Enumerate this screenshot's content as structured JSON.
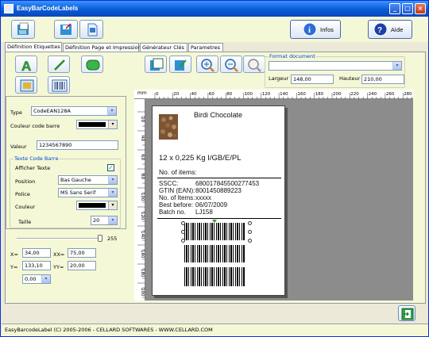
{
  "window": {
    "title": "EasyBarCodeLabels"
  },
  "header": {
    "info_label": "Infos",
    "help_label": "Aide"
  },
  "tabs": [
    "Définition Etiquettes",
    "Définition Page et Impression",
    "Générateur Clés",
    "Parametres"
  ],
  "format": {
    "group_title": "Format document",
    "width_label": "Largeur",
    "width_value": "148,00",
    "height_label": "Hauteur",
    "height_value": "210,00"
  },
  "props": {
    "type_label": "Type",
    "type_value": "CodeEAN128A",
    "color_label": "Couleur code barre",
    "value_label": "Valeur",
    "value": "1234567890",
    "text_group_title": "Texte Code Barre",
    "show_text_label": "Afficher Texte",
    "position_label": "Position",
    "position_value": "Bas Gauche",
    "font_label": "Police",
    "font_value": "MS Sans Serif",
    "text_color_label": "Couleur",
    "size_label": "Taille",
    "size_value": "20"
  },
  "slider": {
    "value": "255"
  },
  "coords": {
    "x_label": "X=",
    "x_value": "34,00",
    "xx_label": "XX=",
    "xx_value": "75,00",
    "y_label": "Y=",
    "y_value": "133,10",
    "yy_label": "YY=",
    "yy_value": "20,00",
    "angle_value": "0,00"
  },
  "ruler": {
    "unit": "mm",
    "ticks": [
      "0",
      "20",
      "40",
      "60",
      "80",
      "100",
      "120",
      "140",
      "160",
      "180",
      "200",
      "220",
      "240",
      "260",
      "280"
    ],
    "v_ticks": [
      "20",
      "40",
      "60",
      "80",
      "100",
      "120",
      "140",
      "160",
      "180",
      "200"
    ]
  },
  "label": {
    "product": "Birdi Chocolate",
    "weight": "12 x 0,225 Kg I/GB/E/PL",
    "items_title": "No. of items:",
    "rows": [
      {
        "k": "SSCC:",
        "v": "680017845500277453"
      },
      {
        "k": "GTIN (EAN):",
        "v": "8001450889223"
      },
      {
        "k": "No. of Items:",
        "v": "xxxxx"
      },
      {
        "k": "Best before:",
        "v": "06/07/2009"
      },
      {
        "k": "Batch no.",
        "v": "LJ158"
      }
    ]
  },
  "status": {
    "text": "EasyBarcodeLabel (C) 2005-2006 - CELLARD SOFTWARES - WWW.CELLARD.COM"
  }
}
